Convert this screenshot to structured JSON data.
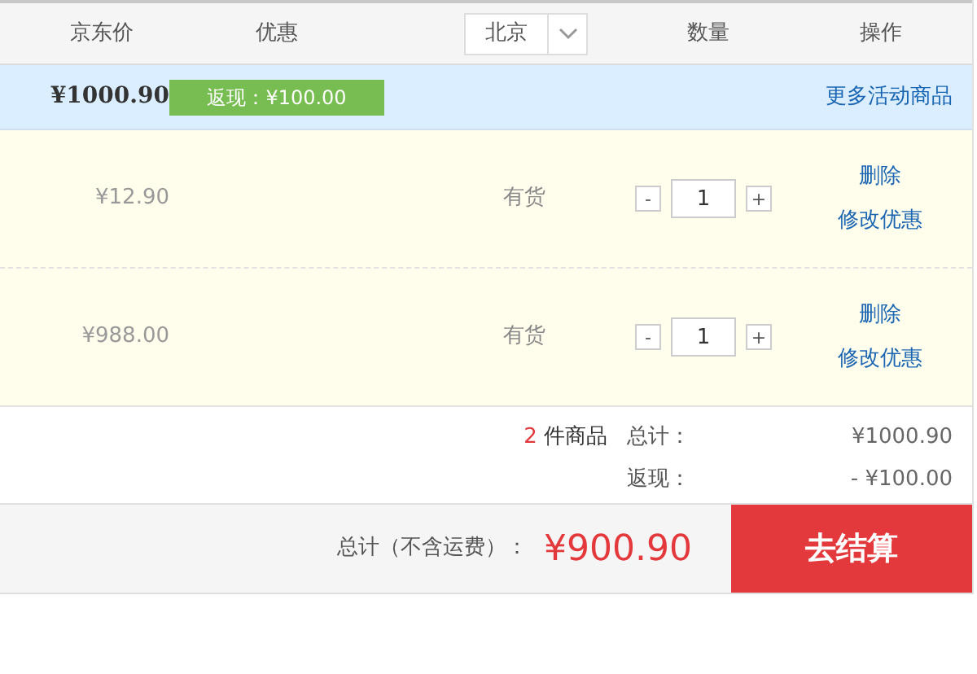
{
  "header": {
    "price": "京东价",
    "discount": "优惠",
    "region": "北京",
    "quantity": "数量",
    "actions": "操作"
  },
  "promo": {
    "price": "¥1000.90",
    "tag": "返现：¥100.00",
    "link": "更多活动商品"
  },
  "items": [
    {
      "price": "¥12.90",
      "stock": "有货",
      "minus": "-",
      "quantity": "1",
      "plus": "+",
      "actions": [
        "删除",
        "修改优惠"
      ]
    },
    {
      "price": "¥988.00",
      "stock": "有货",
      "minus": "-",
      "quantity": "1",
      "plus": "+",
      "actions": [
        "删除",
        "修改优惠"
      ]
    }
  ],
  "summary": {
    "count": "2",
    "count_label": "件商品",
    "lines": [
      {
        "label": "总计：",
        "value": "¥1000.90"
      },
      {
        "label": "返现：",
        "value": "- ¥100.00"
      }
    ]
  },
  "footer": {
    "total_label": "总计（不含运费）：",
    "total": "¥900.90",
    "checkout": "去结算"
  }
}
